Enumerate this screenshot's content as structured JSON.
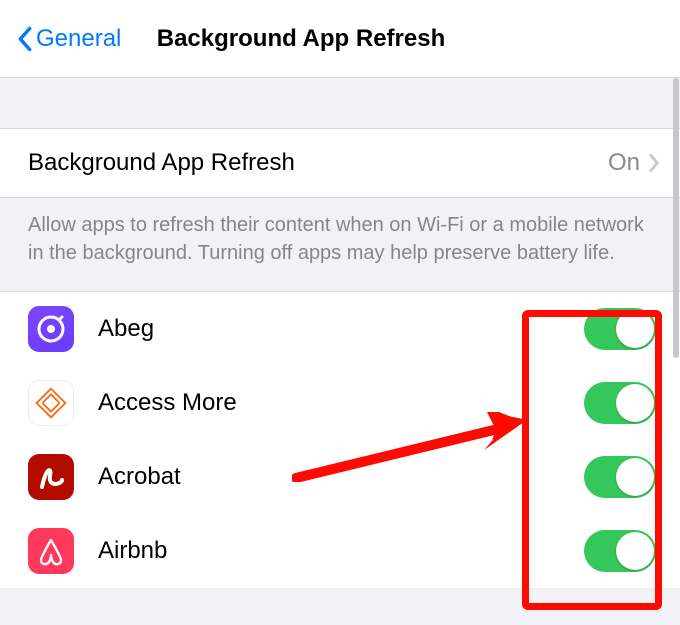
{
  "nav": {
    "back_label": "General",
    "title": "Background App Refresh"
  },
  "master_cell": {
    "title": "Background App Refresh",
    "value": "On"
  },
  "footer": "Allow apps to refresh their content when on Wi-Fi or a mobile network in the background. Turning off apps may help preserve battery life.",
  "apps": [
    {
      "name": "Abeg",
      "icon": "abeg-icon",
      "toggle_on": true
    },
    {
      "name": "Access More",
      "icon": "access-more-icon",
      "toggle_on": true
    },
    {
      "name": "Acrobat",
      "icon": "acrobat-icon",
      "toggle_on": true
    },
    {
      "name": "Airbnb",
      "icon": "airbnb-icon",
      "toggle_on": true
    }
  ],
  "colors": {
    "accent_link": "#007aff",
    "switch_on": "#34c759",
    "annotation": "#ff0a00"
  }
}
